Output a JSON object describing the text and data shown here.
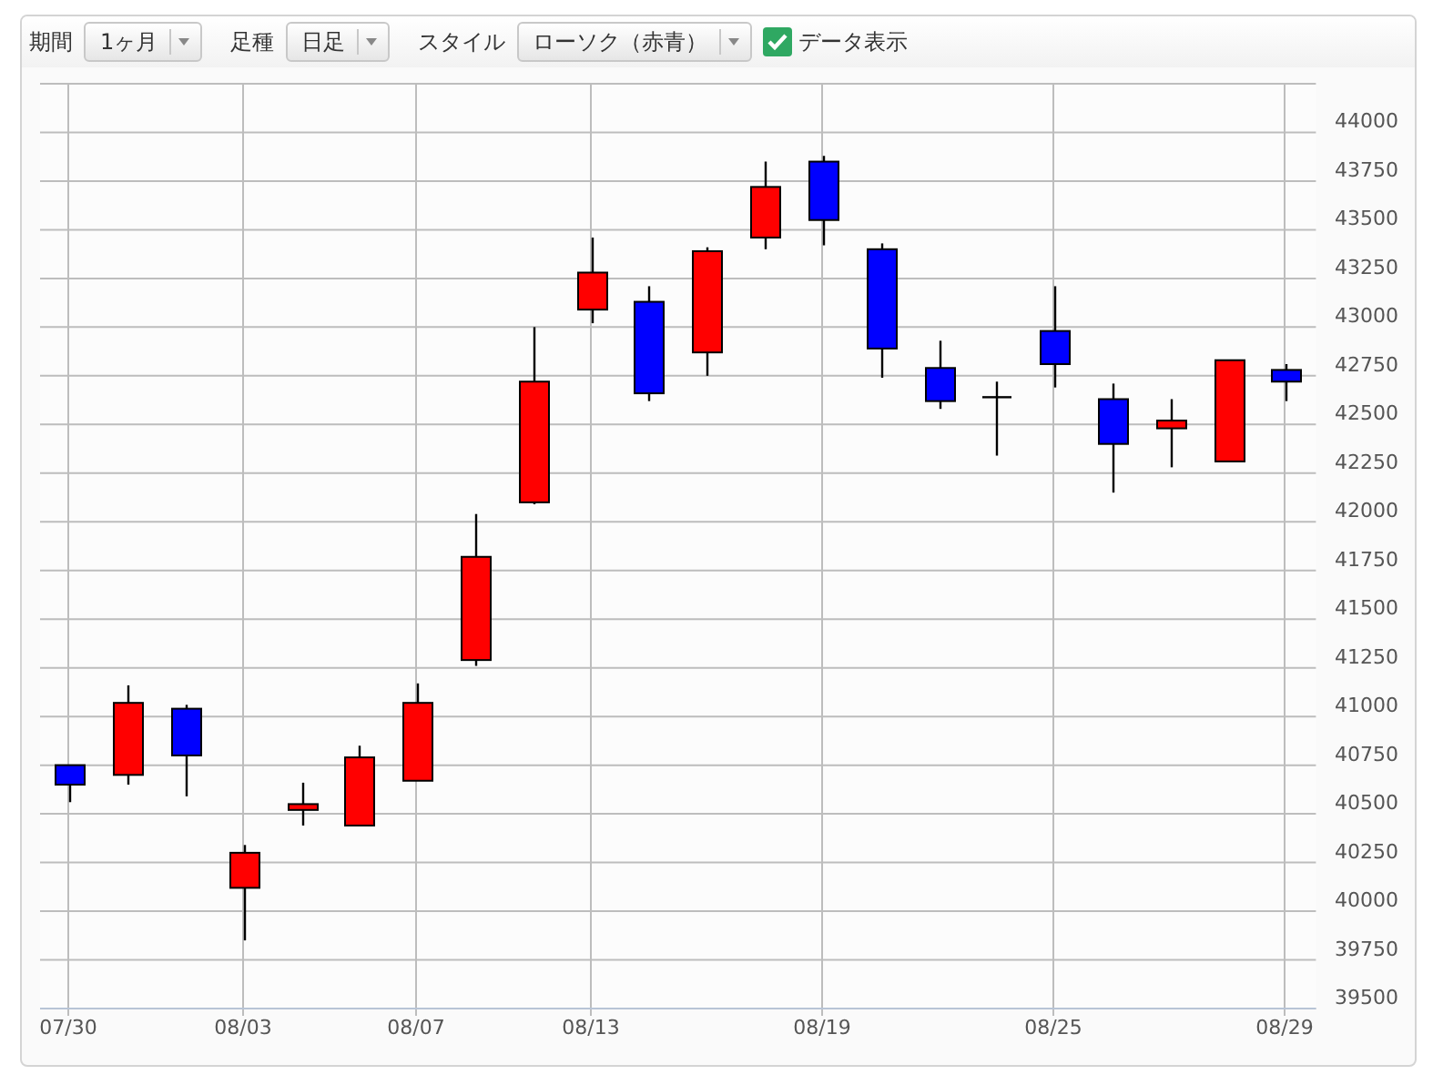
{
  "toolbar": {
    "period": {
      "label": "期間",
      "value": "1ヶ月"
    },
    "candle_type": {
      "label": "足種",
      "value": "日足"
    },
    "style": {
      "label": "スタイル",
      "value": "ローソク（赤青）"
    },
    "show_data": {
      "label": "データ表示",
      "checked": true
    }
  },
  "chart": {
    "chart_data": {
      "type": "candlestick",
      "categories": [
        "07/30",
        null,
        null,
        "08/03",
        null,
        null,
        "08/07",
        null,
        null,
        "08/13",
        null,
        null,
        null,
        "08/19",
        null,
        null,
        null,
        "08/25",
        null,
        null,
        null,
        "08/29"
      ],
      "ohlc": [
        [
          40750,
          40750,
          40560,
          40650
        ],
        [
          40700,
          41160,
          40650,
          41070
        ],
        [
          41040,
          41060,
          40590,
          40800
        ],
        [
          40120,
          40340,
          39850,
          40300
        ],
        [
          40520,
          40660,
          40440,
          40550
        ],
        [
          40440,
          40850,
          40440,
          40790
        ],
        [
          40670,
          41170,
          40670,
          41070
        ],
        [
          41290,
          42040,
          41260,
          41820
        ],
        [
          42100,
          43000,
          42090,
          42720
        ],
        [
          43090,
          43460,
          43020,
          43280
        ],
        [
          43130,
          43210,
          42620,
          42660
        ],
        [
          42870,
          43410,
          42750,
          43390
        ],
        [
          43460,
          43850,
          43400,
          43720
        ],
        [
          43850,
          43880,
          43420,
          43550
        ],
        [
          43400,
          43430,
          42740,
          42890
        ],
        [
          42790,
          42930,
          42580,
          42620
        ],
        [
          42640,
          42720,
          42340,
          42640
        ],
        [
          42980,
          43210,
          42690,
          42810
        ],
        [
          42630,
          42710,
          42150,
          42400
        ],
        [
          42480,
          42630,
          42280,
          42520
        ],
        [
          42310,
          42830,
          42310,
          42830
        ],
        [
          42780,
          42810,
          42620,
          42720
        ]
      ],
      "ylim": [
        39500,
        44250
      ],
      "grid": true,
      "yticks": [
        39500,
        39750,
        40000,
        40250,
        40500,
        40750,
        41000,
        41250,
        41500,
        41750,
        42000,
        42250,
        42500,
        42750,
        43000,
        43250,
        43500,
        43750,
        44000
      ]
    }
  }
}
